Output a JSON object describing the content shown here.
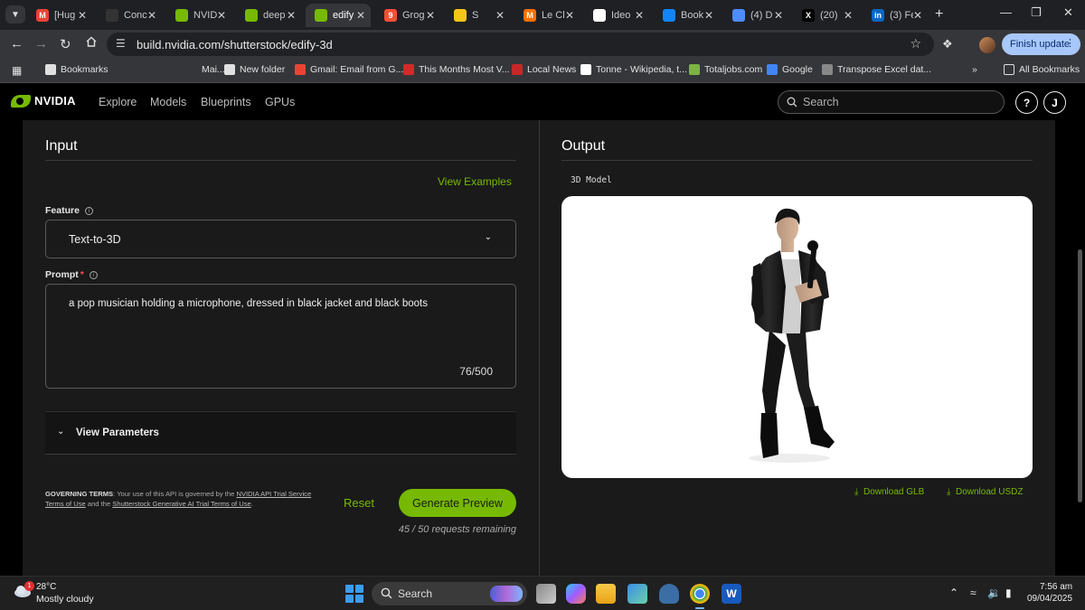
{
  "browser": {
    "tabs": [
      {
        "title": "[Hug",
        "icon": "gmail-icon",
        "color": "#ea4335",
        "glyph": "M"
      },
      {
        "title": "Conc",
        "icon": "dark-app-icon",
        "color": "#333333",
        "glyph": ""
      },
      {
        "title": "NVID",
        "icon": "nvidia-icon",
        "color": "#76b900",
        "glyph": ""
      },
      {
        "title": "deep",
        "icon": "nvidia-icon",
        "color": "#76b900",
        "glyph": ""
      },
      {
        "title": "edify",
        "icon": "nvidia-icon",
        "color": "#76b900",
        "glyph": ""
      },
      {
        "title": "Grog",
        "icon": "groq-icon",
        "color": "#f55036",
        "glyph": "9"
      },
      {
        "title": "S",
        "icon": "smiley-icon",
        "color": "#f5c518",
        "glyph": ""
      },
      {
        "title": "Le Cl",
        "icon": "mistral-icon",
        "color": "#ff7000",
        "glyph": "M"
      },
      {
        "title": "Ideo",
        "icon": "ideogram-icon",
        "color": "#ffffff",
        "glyph": ""
      },
      {
        "title": "Book",
        "icon": "butterfly-icon",
        "color": "#1185fe",
        "glyph": ""
      },
      {
        "title": "(4) D",
        "icon": "chat-icon",
        "color": "#4e8cff",
        "glyph": ""
      },
      {
        "title": "(20)",
        "icon": "x-icon",
        "color": "#000000",
        "glyph": "X"
      },
      {
        "title": "(3) Fe",
        "icon": "linkedin-icon",
        "color": "#0a66c2",
        "glyph": "in"
      }
    ],
    "active_tab": 4,
    "url": "build.nvidia.com/shutterstock/edify-3d",
    "finish_update": "Finish update",
    "bookmarks": [
      {
        "label": "Bookmarks",
        "icon": "star-icon",
        "color": "#e0e0e0"
      },
      {
        "label": "Mai...",
        "icon": "blank-icon",
        "color": "#35363a"
      },
      {
        "label": "New folder",
        "icon": "folder-icon",
        "color": "#e0e0e0"
      },
      {
        "label": "Gmail: Email from G...",
        "icon": "gmail-icon",
        "color": "#ea4335"
      },
      {
        "label": "This Months Most V...",
        "icon": "dr-icon",
        "color": "#d62828"
      },
      {
        "label": "Local News",
        "icon": "news-icon",
        "color": "#c62828"
      },
      {
        "label": "Tonne - Wikipedia, t...",
        "icon": "wikipedia-icon",
        "color": "#ffffff"
      },
      {
        "label": "Totaljobs.com",
        "icon": "totaljobs-icon",
        "color": "#7cb342"
      },
      {
        "label": "Google",
        "icon": "google-icon",
        "color": "#4285f4"
      },
      {
        "label": "Transpose Excel dat...",
        "icon": "transpose-icon",
        "color": "#888888"
      }
    ],
    "all_bookmarks": "All Bookmarks"
  },
  "site": {
    "logo": "NVIDIA",
    "nav": [
      "Explore",
      "Models",
      "Blueprints",
      "GPUs"
    ],
    "search_placeholder": "Search",
    "help_label": "?",
    "avatar_initial": "J"
  },
  "input": {
    "title": "Input",
    "view_examples": "View Examples",
    "feature_label": "Feature",
    "feature_value": "Text-to-3D",
    "prompt_label": "Prompt",
    "prompt_required": "*",
    "prompt_text": "a pop musician holding a microphone, dressed in black jacket and black boots",
    "char_count": "76/500",
    "view_parameters": "View Parameters",
    "terms": {
      "heading": "GOVERNING TERMS",
      "pre": ": Your use of this API is governed by the ",
      "link1": "NVIDIA API Trial Service Terms of Use",
      "mid": " and the ",
      "link2": "Shutterstock Generative AI Trial Terms of Use",
      "post": "."
    },
    "reset": "Reset",
    "generate": "Generate Preview",
    "remaining": "45 / 50 requests remaining"
  },
  "output": {
    "title": "Output",
    "model_label": "3D Model",
    "download_glb": "Download GLB",
    "download_usdz": "Download USDZ"
  },
  "taskbar": {
    "weather_badge": "1",
    "temperature": "28°C",
    "weather": "Mostly cloudy",
    "search": "Search",
    "time": "7:56 am",
    "date": "09/04/2025"
  },
  "colors": {
    "accent": "#76b900",
    "panel": "#1a1a1a",
    "chrome": "#35363a"
  }
}
